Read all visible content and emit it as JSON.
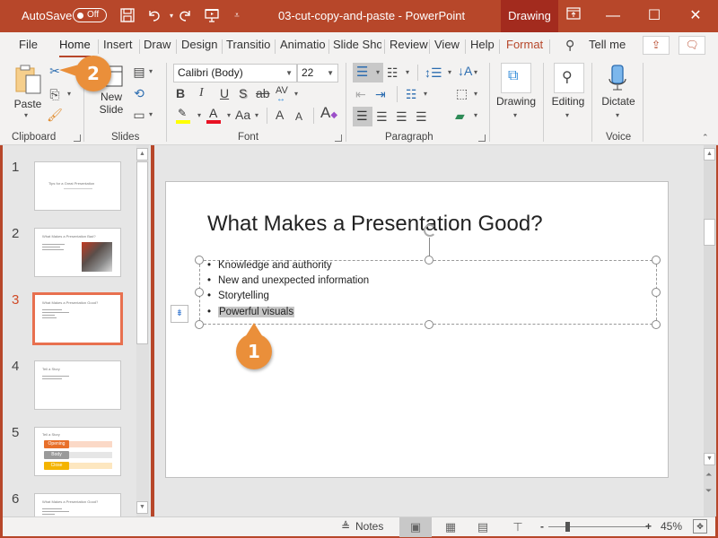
{
  "titlebar": {
    "autosave_label": "AutoSave",
    "autosave_state": "Off",
    "document_title": "03-cut-copy-and-paste - PowerPoint",
    "contextual_tab": "Drawing",
    "icons": [
      "save-icon",
      "undo-icon",
      "redo-icon",
      "present-icon",
      "customize-icon"
    ],
    "window_controls": {
      "minimize": "—",
      "maximize": "☐",
      "close": "✕"
    }
  },
  "menu": {
    "tabs": [
      "File",
      "Home",
      "Insert",
      "Draw",
      "Design",
      "Transitio",
      "Animatio",
      "Slide Sho",
      "Review",
      "View",
      "Help",
      "Format"
    ],
    "active_tab": "Home",
    "tell_me": "Tell me"
  },
  "ribbon": {
    "clipboard": {
      "label": "Clipboard",
      "paste": "Paste"
    },
    "slides": {
      "label": "Slides",
      "new_slide_1": "New",
      "new_slide_2": "Slide"
    },
    "font": {
      "label": "Font",
      "font_name": "Calibri (Body)",
      "font_size": "22",
      "bold": "B",
      "italic": "I",
      "underline": "U",
      "shadow": "S",
      "strike": "ab",
      "spacing": "AV",
      "change_case": "Aa",
      "grow": "A",
      "shrink": "A",
      "highlight_color": "#ffff00",
      "font_color": "#e81123"
    },
    "paragraph": {
      "label": "Paragraph"
    },
    "drawing": {
      "label": "Drawing"
    },
    "editing": {
      "label": "Editing"
    },
    "voice": {
      "label": "Voice",
      "dictate": "Dictate"
    }
  },
  "slides_panel": {
    "current": 3,
    "slides": [
      {
        "num": "1",
        "title": "Tips for a Great Presentation"
      },
      {
        "num": "2",
        "title": "What Makes a Presentation Bad?"
      },
      {
        "num": "3",
        "title": "What Makes a Presentation Good?"
      },
      {
        "num": "4",
        "title": "Tell a Story"
      },
      {
        "num": "5",
        "title": "Tell a Story",
        "rows": [
          "Opening",
          "Body",
          "Close"
        ]
      },
      {
        "num": "6",
        "title": "What Makes a Presentation Good?"
      }
    ]
  },
  "slide": {
    "title": "What Makes a Presentation Good?",
    "bullets": [
      "Knowledge and authority",
      "New and unexpected information",
      "Storytelling",
      "Powerful visuals"
    ],
    "selected_bullet_index": 3
  },
  "callouts": {
    "step1": "1",
    "step2": "2"
  },
  "statusbar": {
    "notes": "Notes",
    "zoom_percent": "45%",
    "zoom_value": 45,
    "zoom_minus": "-",
    "zoom_plus": "+"
  },
  "colors": {
    "accent": "#b7472a",
    "callout": "#ea8f3a",
    "selected_thumb": "#e8704f"
  }
}
